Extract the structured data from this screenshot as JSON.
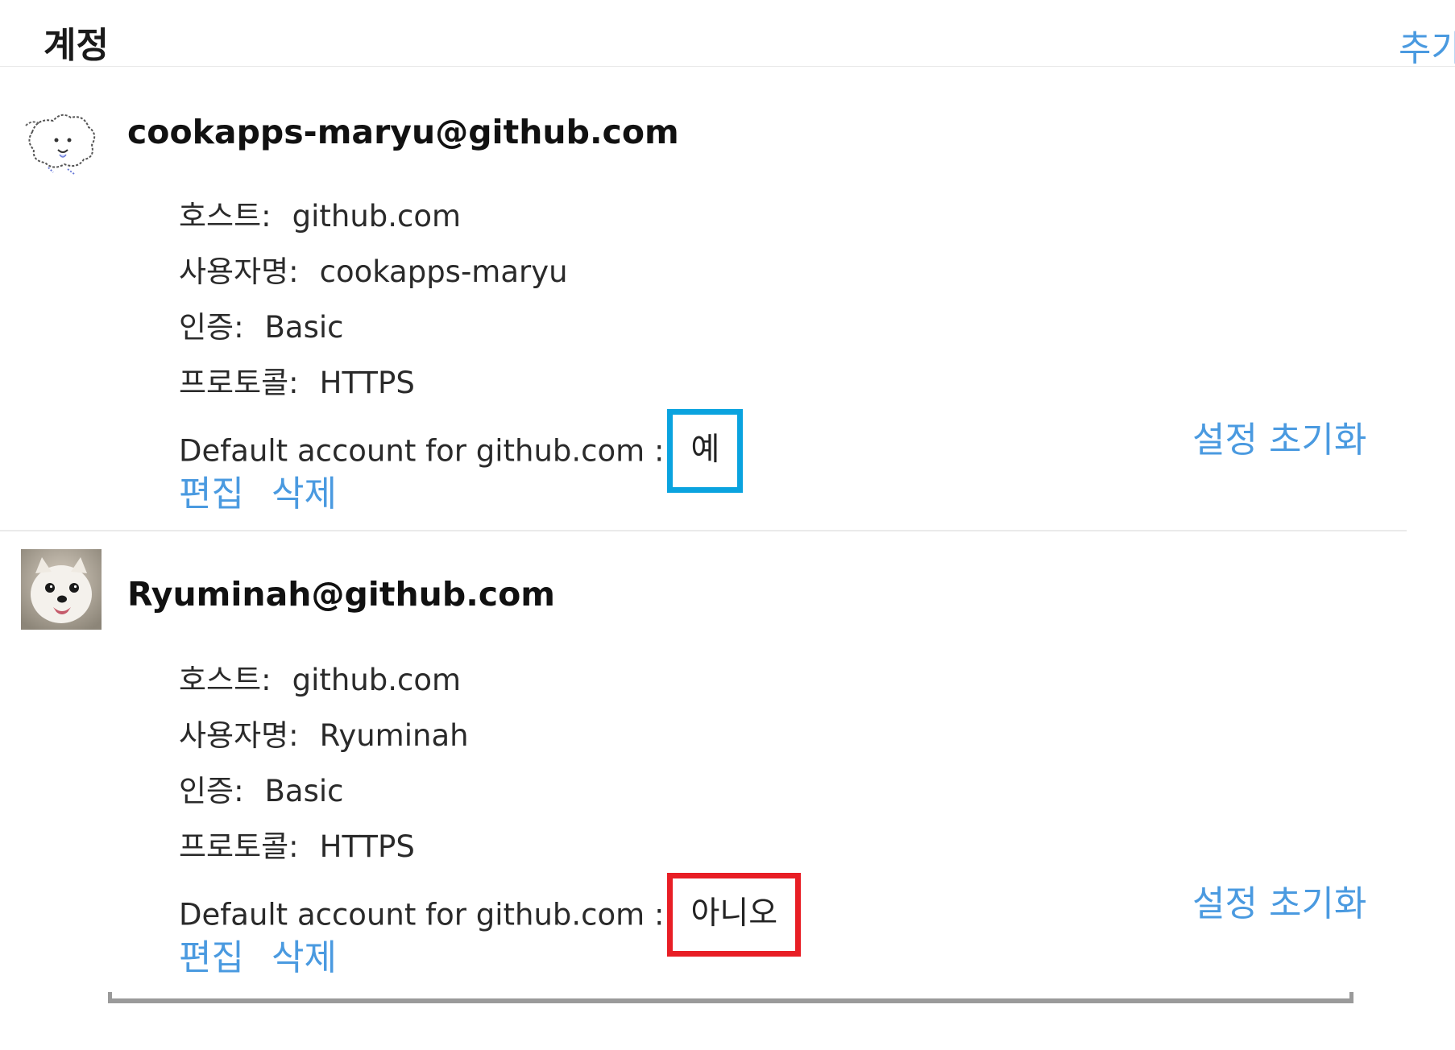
{
  "header": {
    "title": "계정",
    "add_label": "추가"
  },
  "accounts": [
    {
      "email": "cookapps-maryu@github.com",
      "avatar": "cartoon-dog-avatar",
      "host_label": "호스트:",
      "host": "github.com",
      "username_label": "사용자명:",
      "username": "cookapps-maryu",
      "auth_label": "인증:",
      "auth": "Basic",
      "protocol_label": "프로토콜:",
      "protocol": "HTTPS",
      "default_label": "Default account for github.com :",
      "default_value": "예",
      "reset_label": "설정 초기화",
      "edit_label": "편집",
      "delete_label": "삭제"
    },
    {
      "email": "Ryuminah@github.com",
      "avatar": "dog-photo-avatar",
      "host_label": "호스트:",
      "host": "github.com",
      "username_label": "사용자명:",
      "username": "Ryuminah",
      "auth_label": "인증:",
      "auth": "Basic",
      "protocol_label": "프로토콜:",
      "protocol": "HTTPS",
      "default_label": "Default account for github.com :",
      "default_value": "아니오",
      "reset_label": "설정 초기화",
      "edit_label": "편집",
      "delete_label": "삭제"
    }
  ],
  "colors": {
    "link": "#4a9ae0",
    "highlight_yes": "#0aa3df",
    "highlight_no": "#e81e25"
  }
}
